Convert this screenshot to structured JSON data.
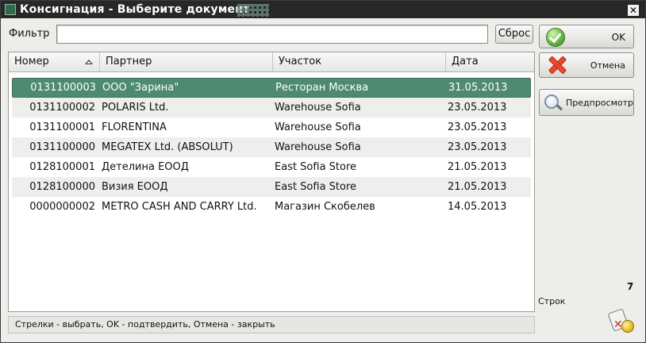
{
  "window": {
    "title": "Консигнация - Выберите документ",
    "close_glyph": "✕"
  },
  "filter": {
    "label": "Фильтр",
    "value": "",
    "reset_label": "Сброс"
  },
  "table": {
    "columns": [
      "Номер",
      "Партнер",
      "Участок",
      "Дата"
    ],
    "sort_column": "Номер",
    "sort_direction": "asc",
    "selected_row": 0,
    "rows": [
      {
        "num": "0131100003",
        "partner": "ООО \"Зарина\"",
        "area": "Ресторан Москва",
        "date": "31.05.2013"
      },
      {
        "num": "0131100002",
        "partner": "POLARIS Ltd.",
        "area": "Warehouse Sofia",
        "date": "23.05.2013"
      },
      {
        "num": "0131100001",
        "partner": "FLORENTINA",
        "area": "Warehouse Sofia",
        "date": "23.05.2013"
      },
      {
        "num": "0131100000",
        "partner": "MEGATEX Ltd. (ABSOLUT)",
        "area": "Warehouse Sofia",
        "date": "23.05.2013"
      },
      {
        "num": "0128100001",
        "partner": "Детелина ЕООД",
        "area": "East Sofia Store",
        "date": "21.05.2013"
      },
      {
        "num": "0128100000",
        "partner": "Визия ЕООД",
        "area": "East Sofia Store",
        "date": "21.05.2013"
      },
      {
        "num": "0000000002",
        "partner": "METRO CASH AND CARRY Ltd.",
        "area": "Магазин Скобелев",
        "date": "14.05.2013"
      }
    ]
  },
  "status": {
    "hint": "Стрелки - выбрать, OK - подтвердить, Отмена - закрыть"
  },
  "buttons": {
    "ok": "OK",
    "cancel": "Отмена",
    "preview": "Предпросмотр"
  },
  "row_count": {
    "value": "7",
    "label": "Строк"
  },
  "icons": {
    "ok": "check-circle-icon",
    "cancel": "red-x-icon",
    "preview": "magnifier-icon",
    "sort": "sort-ascending-icon",
    "footer": "price-tag-coin-icon"
  },
  "colors": {
    "selection": "#4e8a71",
    "titlebar": "#28282a"
  }
}
